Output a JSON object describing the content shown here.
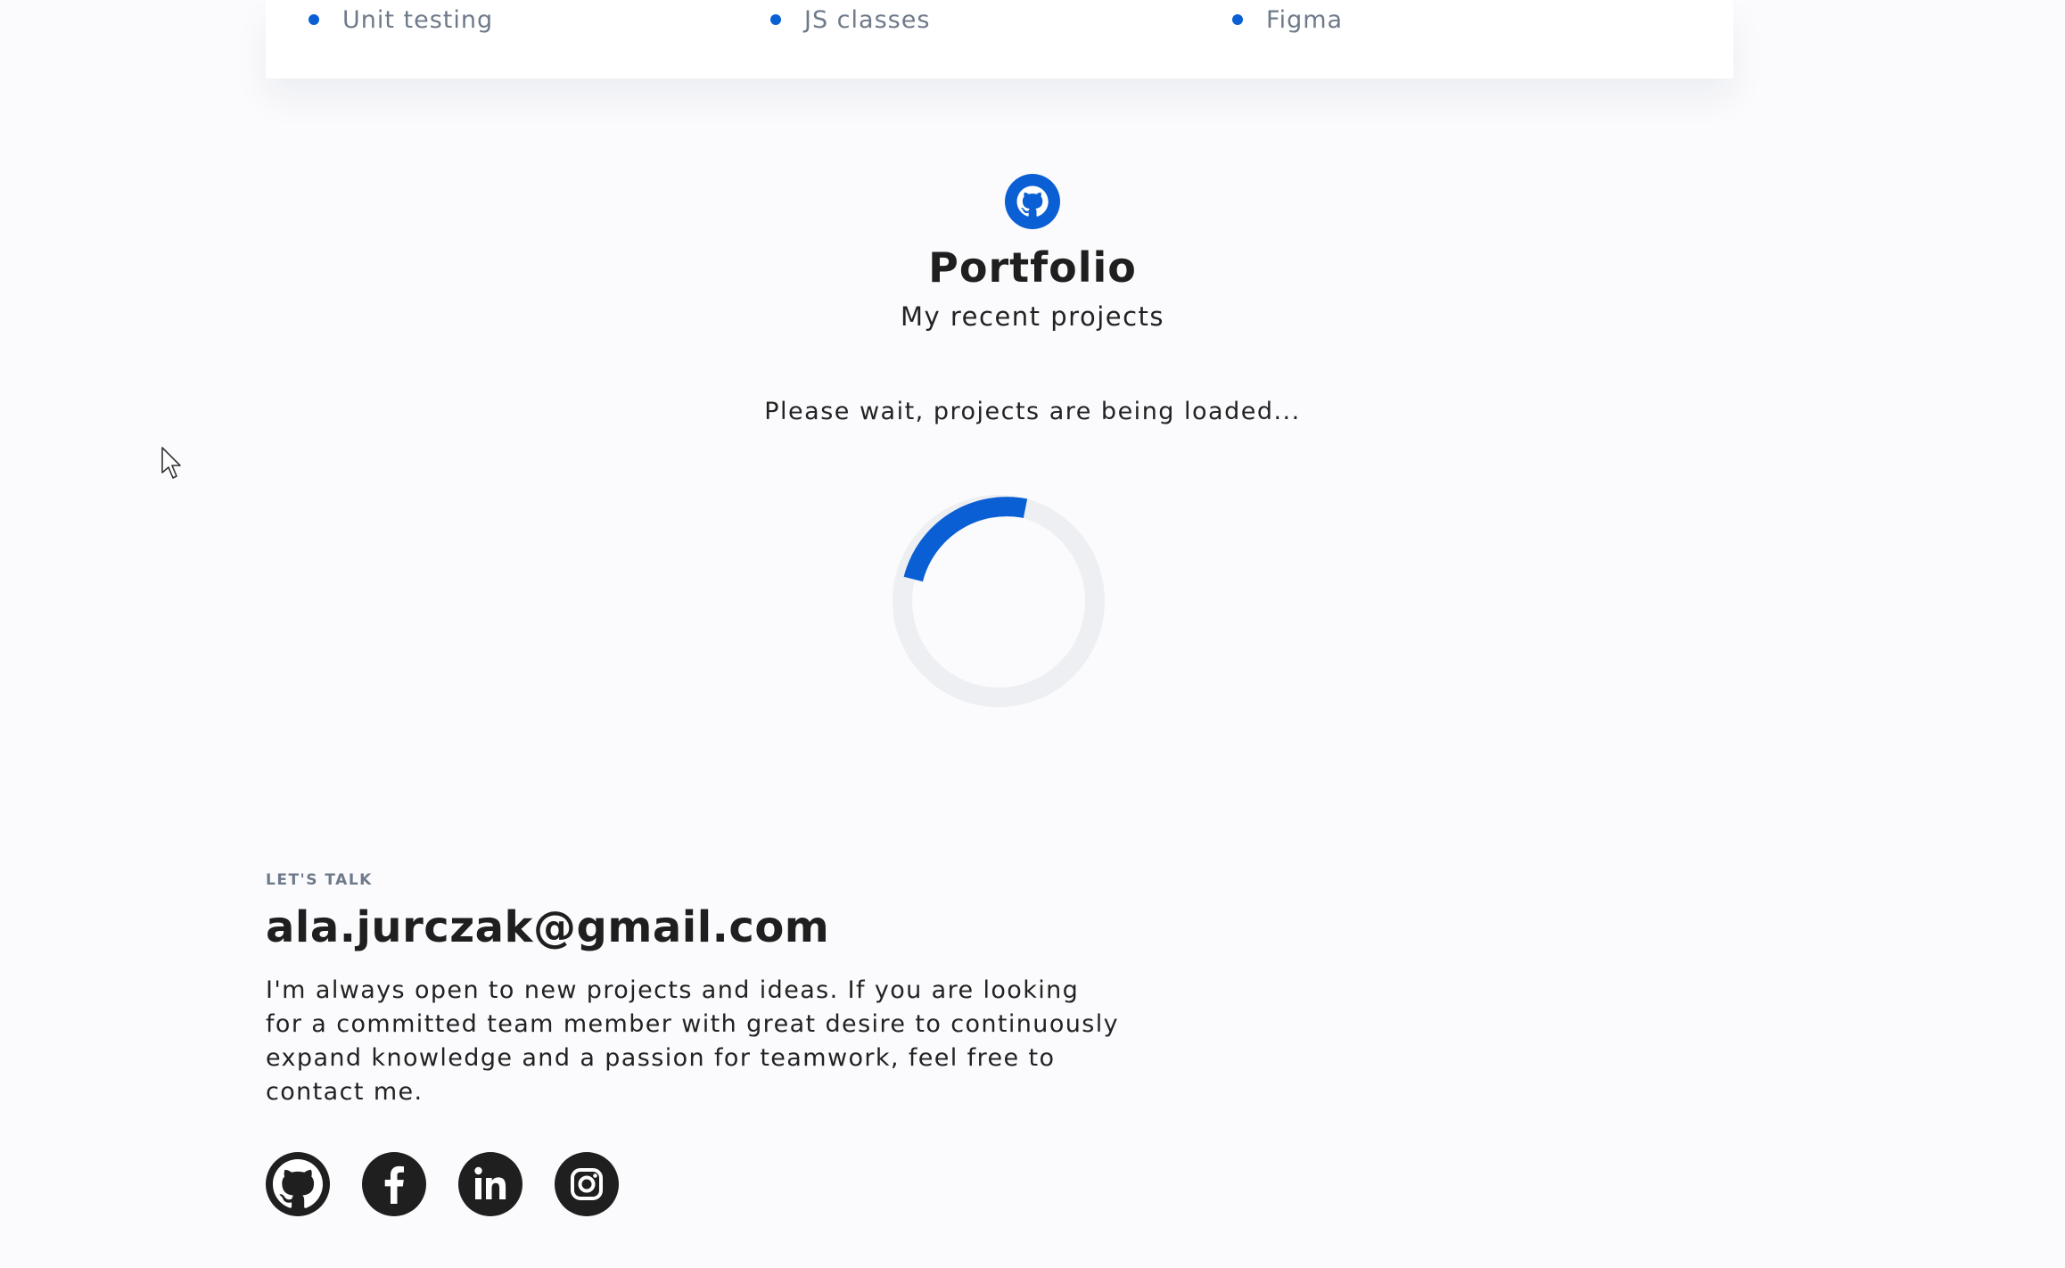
{
  "skills": {
    "items": [
      "Unit testing",
      "JS classes",
      "Figma"
    ]
  },
  "portfolio": {
    "icon": "github-icon",
    "title": "Portfolio",
    "subtitle": "My recent projects",
    "loading_text": "Please wait, projects are being loaded..."
  },
  "contact": {
    "eyebrow": "LET'S TALK",
    "email": "ala.jurczak@gmail.com",
    "text": "I'm always open to new projects and ideas. If you are looking for a committed team member with great desire to continuously expand knowledge and a passion for teamwork, feel free to contact me.",
    "socials": [
      {
        "icon": "github-icon"
      },
      {
        "icon": "facebook-icon"
      },
      {
        "icon": "linkedin-icon"
      },
      {
        "icon": "instagram-icon"
      }
    ]
  },
  "colors": {
    "accent": "#0a5fd4",
    "background": "#fbfbfd",
    "text": "#1f1f1f",
    "muted": "#6e7a8a",
    "spinner_track": "#eeeff2"
  }
}
